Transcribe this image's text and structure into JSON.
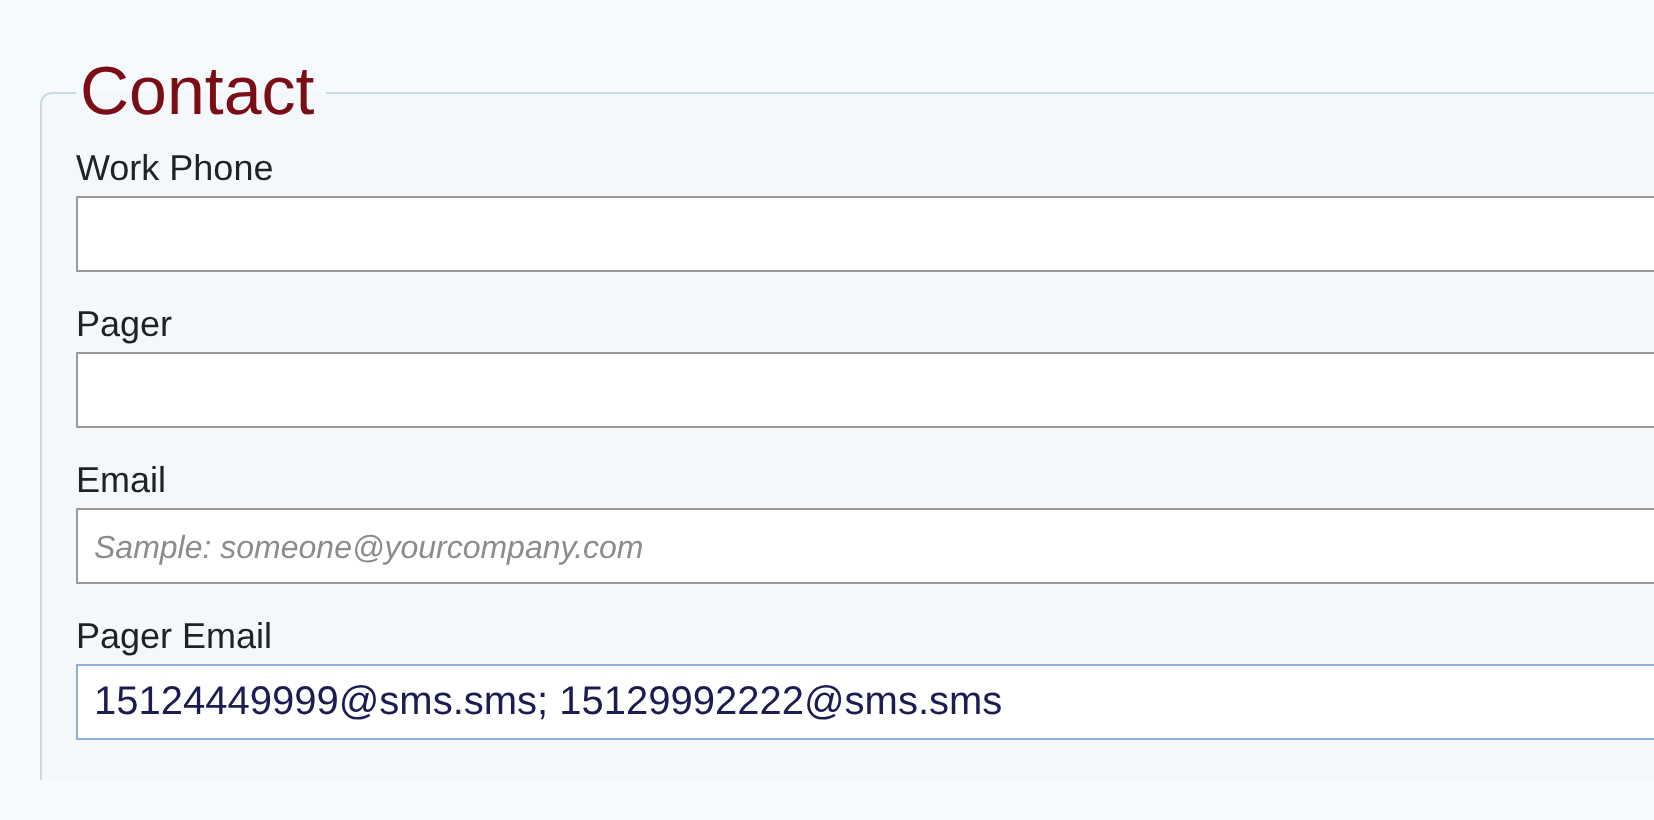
{
  "section": {
    "title": "Contact"
  },
  "fields": [
    {
      "label": "Work Phone",
      "focused": false
    },
    {
      "label": "Pager",
      "focused": false
    },
    {
      "label": "Email",
      "placeholder": "Sample: someone@yourcompany.com",
      "focused": false
    },
    {
      "label": "Pager Email",
      "value": "15124449999@sms.sms; 15129992222@sms.sms",
      "focused": true
    }
  ]
}
